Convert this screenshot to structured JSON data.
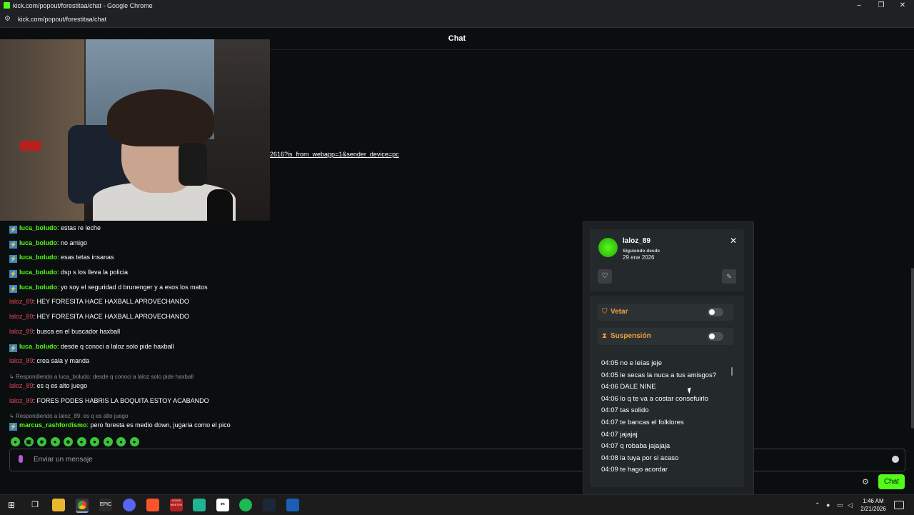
{
  "window": {
    "title": "kick.com/popout/forestitaa/chat - Google Chrome",
    "url": "kick.com/popout/forestitaa/chat",
    "controls": [
      "–",
      "❐",
      "✕"
    ]
  },
  "chat": {
    "header": "Chat",
    "link_fragment": "2616?is_from_webapp=1&sender_device=pc",
    "messages": [
      {
        "user": "luca_boludo",
        "text": ": estas re leche",
        "badge": true,
        "color": "green"
      },
      {
        "user": "luca_boludo",
        "text": ": no amigo",
        "badge": true,
        "color": "green"
      },
      {
        "user": "luca_boludo",
        "text": ": esas tetas insanas",
        "badge": true,
        "color": "green"
      },
      {
        "user": "luca_boludo",
        "text": ": dsp s los lleva la policia",
        "badge": true,
        "color": "green"
      },
      {
        "user": "luca_boludo",
        "text": ": yo soy el seguridad d brunenger y a esos los matos",
        "badge": true,
        "color": "green"
      },
      {
        "user": "laloz_89",
        "text": ": HEY FORESITA HACE HAXBALL APROVECHANDO",
        "badge": false,
        "color": "red"
      },
      {
        "user": "laloz_89",
        "text": ": HEY FORESITA HACE HAXBALL APROVECHANDO",
        "badge": false,
        "color": "red"
      },
      {
        "user": "laloz_89",
        "text": ": busca en el buscador haxball",
        "badge": false,
        "color": "red"
      },
      {
        "user": "luca_boludo",
        "text": ": desde q conoci a laloz solo pide haxball",
        "badge": true,
        "color": "green"
      },
      {
        "user": "laloz_89",
        "text": ": crea sala y manda",
        "badge": false,
        "color": "red"
      },
      {
        "reply": "Respondiendo a luca_boludo: desde q conoci a laloz solo pide haxball",
        "user": "laloz_89",
        "text": ": es q es alto juego",
        "badge": false,
        "color": "red"
      },
      {
        "user": "laloz_89",
        "text": ": FORES PODES HABRIS LA BOQUITA ESTOY ACABANDO",
        "badge": false,
        "color": "red"
      },
      {
        "reply": "Respondiendo a laloz_89: es q es alto juego",
        "user": "marcus_rashfordismo",
        "text": ": pero foresta es medio down, jugaria como el pico",
        "badge": true,
        "color": "green"
      }
    ],
    "emotes": [
      "●",
      "▣",
      "☻",
      "●",
      "☻",
      "●",
      "●",
      "●",
      "●",
      "●"
    ],
    "input_placeholder": "Enviar un mensaje",
    "send_label": "Chat"
  },
  "user_card": {
    "username": "laloz_89",
    "since_label": "Siguiendo desde",
    "since_date": "29 ene 2026",
    "ban_label": "Vetar",
    "timeout_label": "Suspensión",
    "log": [
      "04:05 no e leías jeje",
      "04:05 le secas la nuca a tus amisgos?",
      "04:06 DALE NINE",
      "04:06 lo q te va a costar consefuirlo",
      "04:07 tas solido",
      "04:07 te bancas el folklores",
      "04:07 jajajaj",
      "04:07 q robaba jajajaja",
      "04:08 la tuya por si acaso",
      "04:09 te hago acordar"
    ]
  },
  "taskbar": {
    "apps": [
      "windows-start",
      "task-view",
      "file-explorer",
      "chrome",
      "epic-games",
      "discord",
      "brave",
      "voicemeeter",
      "app",
      "capcut",
      "spotify",
      "steam",
      "rocket-league"
    ],
    "time": "1:46 AM",
    "date": "2/21/2026",
    "epic_label": "EPIC",
    "voice_label": "VOICE MEETER"
  },
  "colors": {
    "accent": "#53fc18",
    "mod_user": "#e0455a",
    "warning": "#f0a040"
  }
}
